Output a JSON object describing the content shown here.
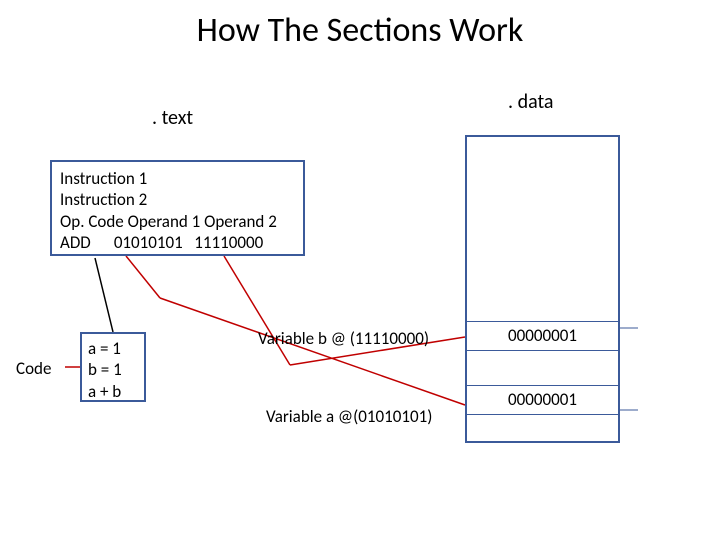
{
  "title": "How The Sections Work",
  "sections": {
    "text": ". text",
    "data": ". data"
  },
  "instructions": {
    "line1": "Instruction 1",
    "line2": "Instruction 2",
    "line3": "Op. Code Operand 1 Operand 2",
    "line4": "ADD      01010101   11110000"
  },
  "code_label": "Code",
  "code": {
    "line1": "a = 1",
    "line2": "b = 1",
    "line3": "a + b"
  },
  "var_b_label": "Variable b @ (11110000)",
  "var_a_label": "Variable a @(01010101)",
  "memory": {
    "b_value": "00000001",
    "a_value": "00000001"
  }
}
